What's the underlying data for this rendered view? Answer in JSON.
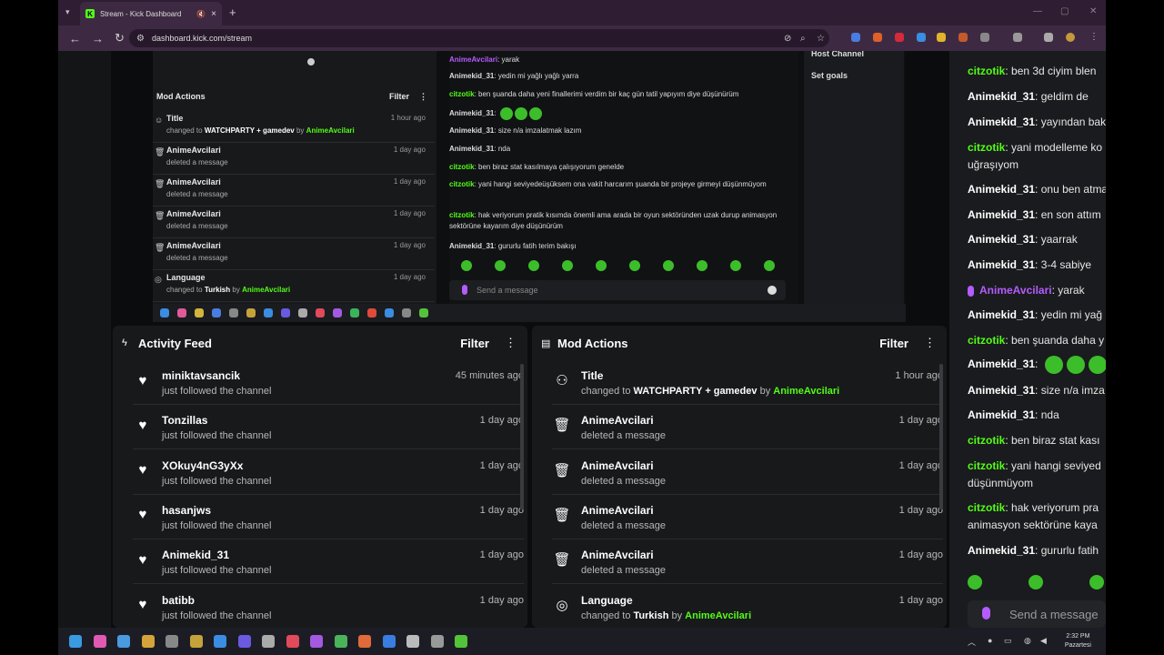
{
  "browser": {
    "tab_title": "Stream - Kick Dashboard",
    "url": "dashboard.kick.com/stream",
    "favicon": "K"
  },
  "embedded": {
    "mod_actions_title": "Mod Actions",
    "filter_label": "Filter",
    "rows": [
      {
        "name": "Title",
        "sub_prefix": "changed to",
        "value": "WATCHPARTY + gamedev",
        "by": "by",
        "user": "AnimeAvcilari",
        "time": "1 hour ago"
      },
      {
        "name": "AnimeAvcilari",
        "sub": "deleted a message",
        "time": "1 day ago"
      },
      {
        "name": "AnimeAvcilari",
        "sub": "deleted a message",
        "time": "1 day ago"
      },
      {
        "name": "AnimeAvcilari",
        "sub": "deleted a message",
        "time": "1 day ago"
      },
      {
        "name": "AnimeAvcilari",
        "sub": "deleted a message",
        "time": "1 day ago"
      },
      {
        "name": "Language",
        "sub_prefix": "changed to",
        "value": "Turkish",
        "by": "by",
        "user": "AnimeAvcilari",
        "time": "1 day ago"
      }
    ],
    "chat": [
      {
        "user": "AnimeAvcilari",
        "text": "yarak"
      },
      {
        "user": "Animekid_31",
        "text": "yedin mi yağlı yağlı yarra"
      },
      {
        "user": "citzotik",
        "text": "ben şuanda daha yeni finallerimi verdim bir kaç gün tatil yapıyım diye düşünürüm"
      },
      {
        "user": "Animekid_31",
        "text": ""
      },
      {
        "user": "Animekid_31",
        "text": "size n/a imzalatmak lazım"
      },
      {
        "user": "Animekid_31",
        "text": "nda"
      },
      {
        "user": "citzotik",
        "text": "ben biraz stat kasılmaya çalışıyorum genelde"
      },
      {
        "user": "citzotik",
        "text": "yani hangi seviyedeüşüksem ona vakit harcarım şuanda bir projeye girmeyi düşünmüyom"
      },
      {
        "user": "citzotik",
        "text": "hak veriyorum pratik kısımda önemli ama arada bir oyun sektöründen uzak durup animasyon sektörüne kayarım diye düşünürüm"
      },
      {
        "user": "Animekid_31",
        "text": "gururlu fatih terim bakışı"
      }
    ],
    "send_placeholder": "Send a message",
    "side": [
      "Host Channel",
      "Set goals"
    ]
  },
  "activity": {
    "title": "Activity Feed",
    "filter_label": "Filter",
    "rows": [
      {
        "name": "miniktavsancik",
        "sub": "just followed the channel",
        "time": "45 minutes ago"
      },
      {
        "name": "Tonzillas",
        "sub": "just followed the channel",
        "time": "1 day ago"
      },
      {
        "name": "XOkuy4nG3yXx",
        "sub": "just followed the channel",
        "time": "1 day ago"
      },
      {
        "name": "hasanjws",
        "sub": "just followed the channel",
        "time": "1 day ago"
      },
      {
        "name": "Animekid_31",
        "sub": "just followed the channel",
        "time": "1 day ago"
      },
      {
        "name": "batibb",
        "sub": "just followed the channel",
        "time": "1 day ago"
      }
    ]
  },
  "mod": {
    "title": "Mod Actions",
    "filter_label": "Filter",
    "rows": [
      {
        "name": "Title",
        "sub_prefix": "changed to",
        "value": "WATCHPARTY + gamedev",
        "by": "by",
        "user": "AnimeAvcilari",
        "time": "1 hour ago"
      },
      {
        "name": "AnimeAvcilari",
        "sub": "deleted a message",
        "time": "1 day ago"
      },
      {
        "name": "AnimeAvcilari",
        "sub": "deleted a message",
        "time": "1 day ago"
      },
      {
        "name": "AnimeAvcilari",
        "sub": "deleted a message",
        "time": "1 day ago"
      },
      {
        "name": "AnimeAvcilari",
        "sub": "deleted a message",
        "time": "1 day ago"
      },
      {
        "name": "Language",
        "sub_prefix": "changed to",
        "value": "Turkish",
        "by": "by",
        "user": "AnimeAvcilari",
        "time": "1 day ago"
      }
    ]
  },
  "chat": [
    {
      "user": "citzotik",
      "text": "ben 3d ciyim blen",
      "color": "green"
    },
    {
      "user": "Animekid_31",
      "text": "geldim de",
      "color": "white"
    },
    {
      "user": "Animekid_31",
      "text": "yayından bak",
      "color": "white"
    },
    {
      "user": "citzotik",
      "text": "yani modelleme ko uğraşıyom",
      "color": "green"
    },
    {
      "user": "Animekid_31",
      "text": "onu ben atma",
      "color": "white"
    },
    {
      "user": "Animekid_31",
      "text": "en son attım",
      "color": "white"
    },
    {
      "user": "Animekid_31",
      "text": "yaarrak",
      "color": "white"
    },
    {
      "user": "Animekid_31",
      "text": "3-4 sabiye",
      "color": "white"
    },
    {
      "user": "AnimeAvcilari",
      "text": "yarak",
      "color": "purple"
    },
    {
      "user": "Animekid_31",
      "text": "yedin mi yağ",
      "color": "white"
    },
    {
      "user": "citzotik",
      "text": "ben şuanda daha y",
      "color": "green"
    },
    {
      "user": "Animekid_31",
      "text": "",
      "color": "white"
    },
    {
      "user": "Animekid_31",
      "text": "size n/a imza",
      "color": "white"
    },
    {
      "user": "Animekid_31",
      "text": "nda",
      "color": "white"
    },
    {
      "user": "citzotik",
      "text": "ben biraz stat kası",
      "color": "green"
    },
    {
      "user": "citzotik",
      "text": "yani hangi seviyed düşünmüyom",
      "color": "green"
    },
    {
      "user": "citzotik",
      "text": "hak veriyorum pra animasyon sektörüne kaya",
      "color": "green"
    },
    {
      "user": "Animekid_31",
      "text": "gururlu fatih",
      "color": "white"
    }
  ],
  "chat_input_placeholder": "Send a message",
  "taskbar": {
    "time": "2:32 PM",
    "day": "Pazartesi"
  }
}
